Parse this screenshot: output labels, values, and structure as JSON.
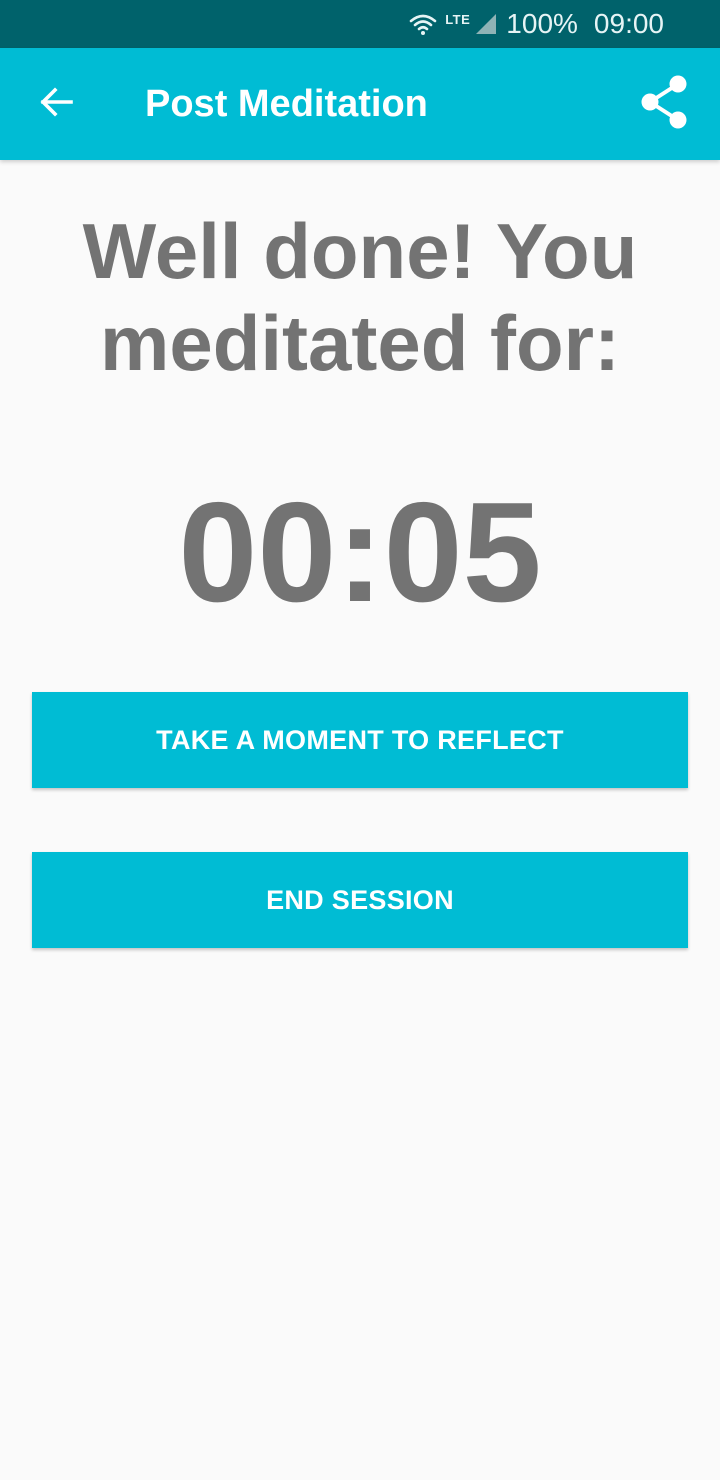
{
  "status_bar": {
    "wifi_icon": "wifi-icon",
    "network_type": "LTE",
    "signal_icon": "signal-icon",
    "battery": "100%",
    "time": "09:00"
  },
  "app_bar": {
    "back_icon": "arrow-back-icon",
    "title": "Post Meditation",
    "share_icon": "share-icon"
  },
  "main": {
    "headline": "Well done! You meditated for:",
    "duration": "00:05",
    "reflect_button_label": "TAKE A MOMENT TO REFLECT",
    "end_button_label": "END SESSION"
  },
  "colors": {
    "status_bar": "#00626b",
    "accent": "#00bcd4",
    "background": "#fafafa",
    "text_gray": "#737373"
  }
}
